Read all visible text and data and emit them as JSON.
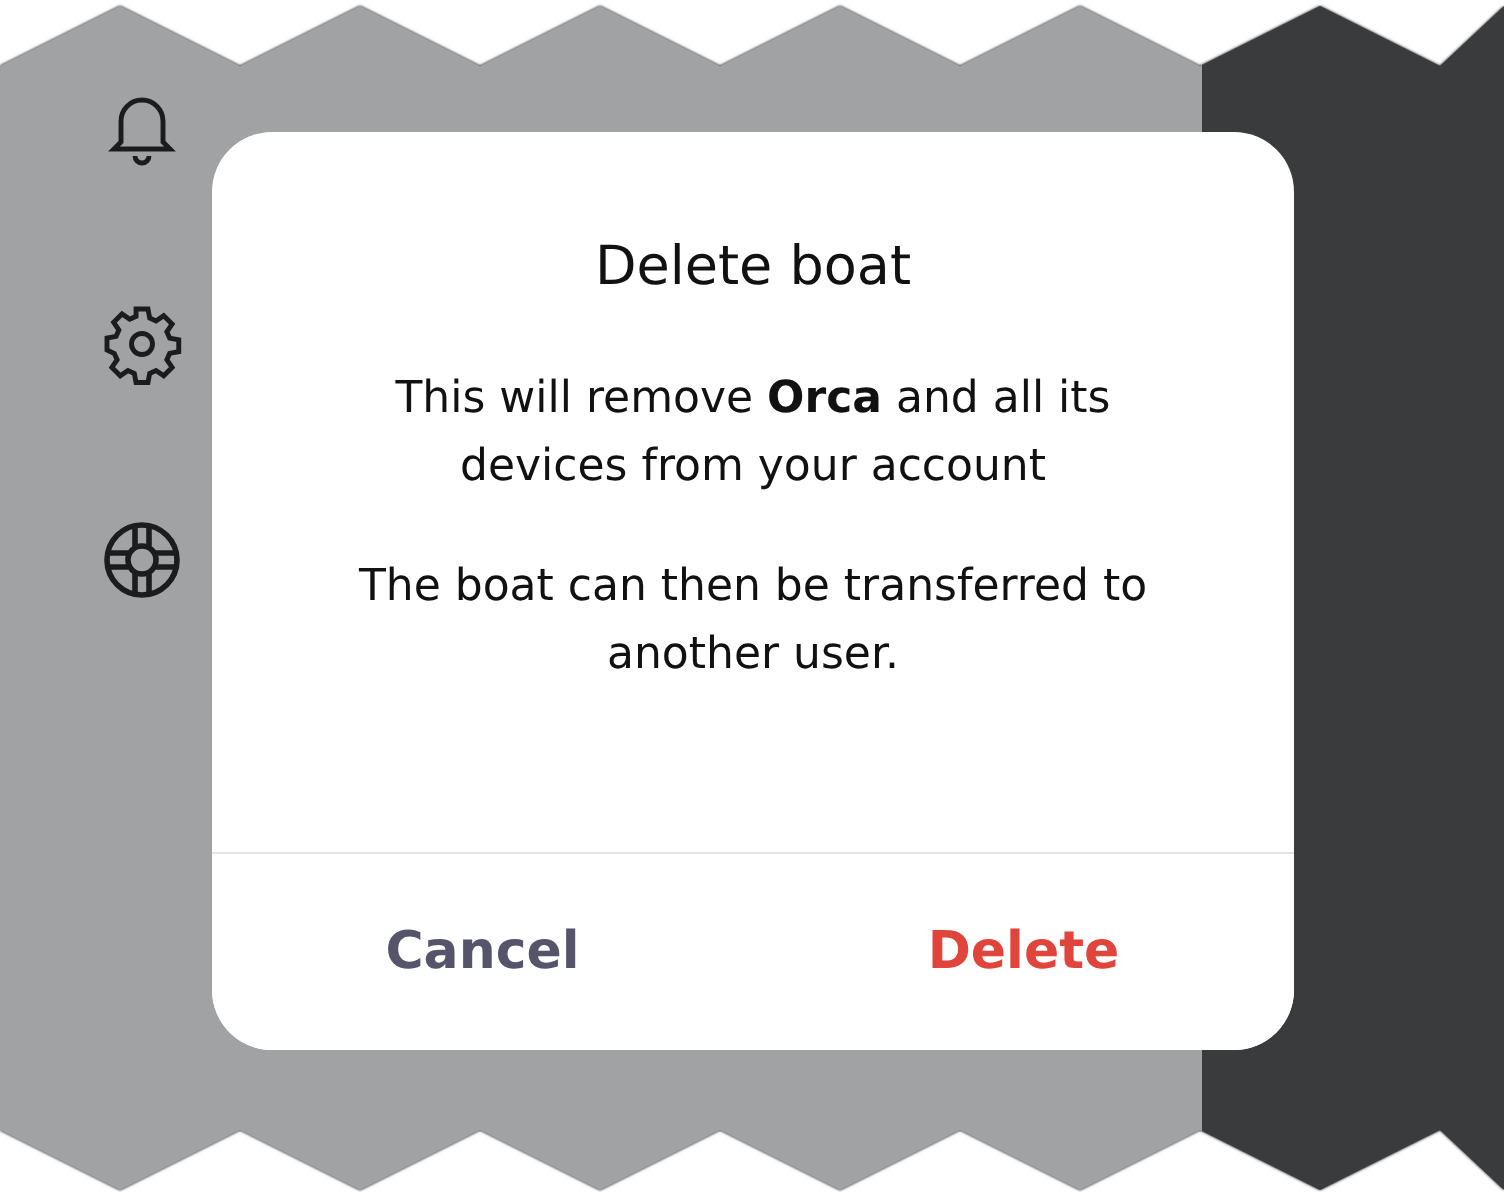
{
  "sidebar": {
    "items": [
      {
        "kind": "bell"
      },
      {
        "kind": "gear"
      },
      {
        "kind": "lifebuoy"
      }
    ]
  },
  "dialog": {
    "title": "Delete boat",
    "paragraphs": [
      "This will remove  **Orca** and all its devices from your account",
      "The boat can then be transferred to another user."
    ],
    "buttons": [
      {
        "label": "Cancel",
        "kind": "cancel"
      },
      {
        "label": "Delete",
        "kind": "destructive"
      }
    ]
  }
}
